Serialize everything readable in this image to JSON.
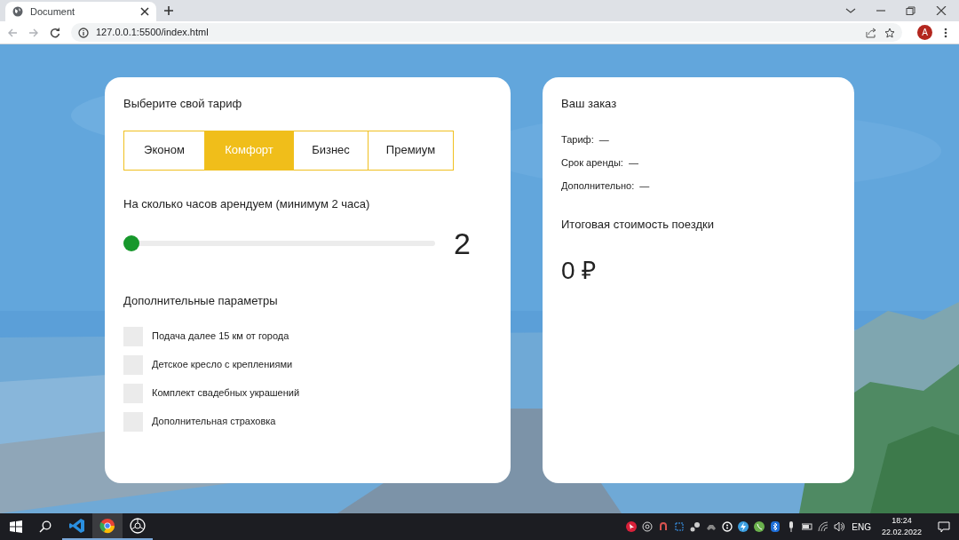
{
  "browser": {
    "tab_title": "Document",
    "address": "127.0.0.1:5500/index.html",
    "profile_initial": "A"
  },
  "tariff": {
    "heading": "Выберите свой тариф",
    "options": [
      {
        "label": "Эконом",
        "selected": false
      },
      {
        "label": "Комфорт",
        "selected": true
      },
      {
        "label": "Бизнес",
        "selected": false
      },
      {
        "label": "Премиум",
        "selected": false
      }
    ]
  },
  "hours": {
    "heading": "На сколько часов арендуем (минимум 2 часа)",
    "level": 0,
    "reading": "2"
  },
  "extras": {
    "heading": "Дополнительные параметры",
    "items": [
      {
        "label": "Подача далее 15 км от города",
        "checked": false
      },
      {
        "label": "Детское кресло с креплениями",
        "checked": false
      },
      {
        "label": "Комплект свадебных украшений",
        "checked": false
      },
      {
        "label": "Дополнительная страховка",
        "checked": false
      }
    ]
  },
  "order": {
    "heading": "Ваш заказ",
    "lines": [
      "Тариф:  —",
      "Срок аренды:  —",
      "Дополнительно:  —"
    ],
    "total_heading": "Итоговая стоимость поездки",
    "total": "0 ₽"
  },
  "taskbar": {
    "language": "ENG",
    "time": "18:24",
    "date": "22.02.2022"
  }
}
